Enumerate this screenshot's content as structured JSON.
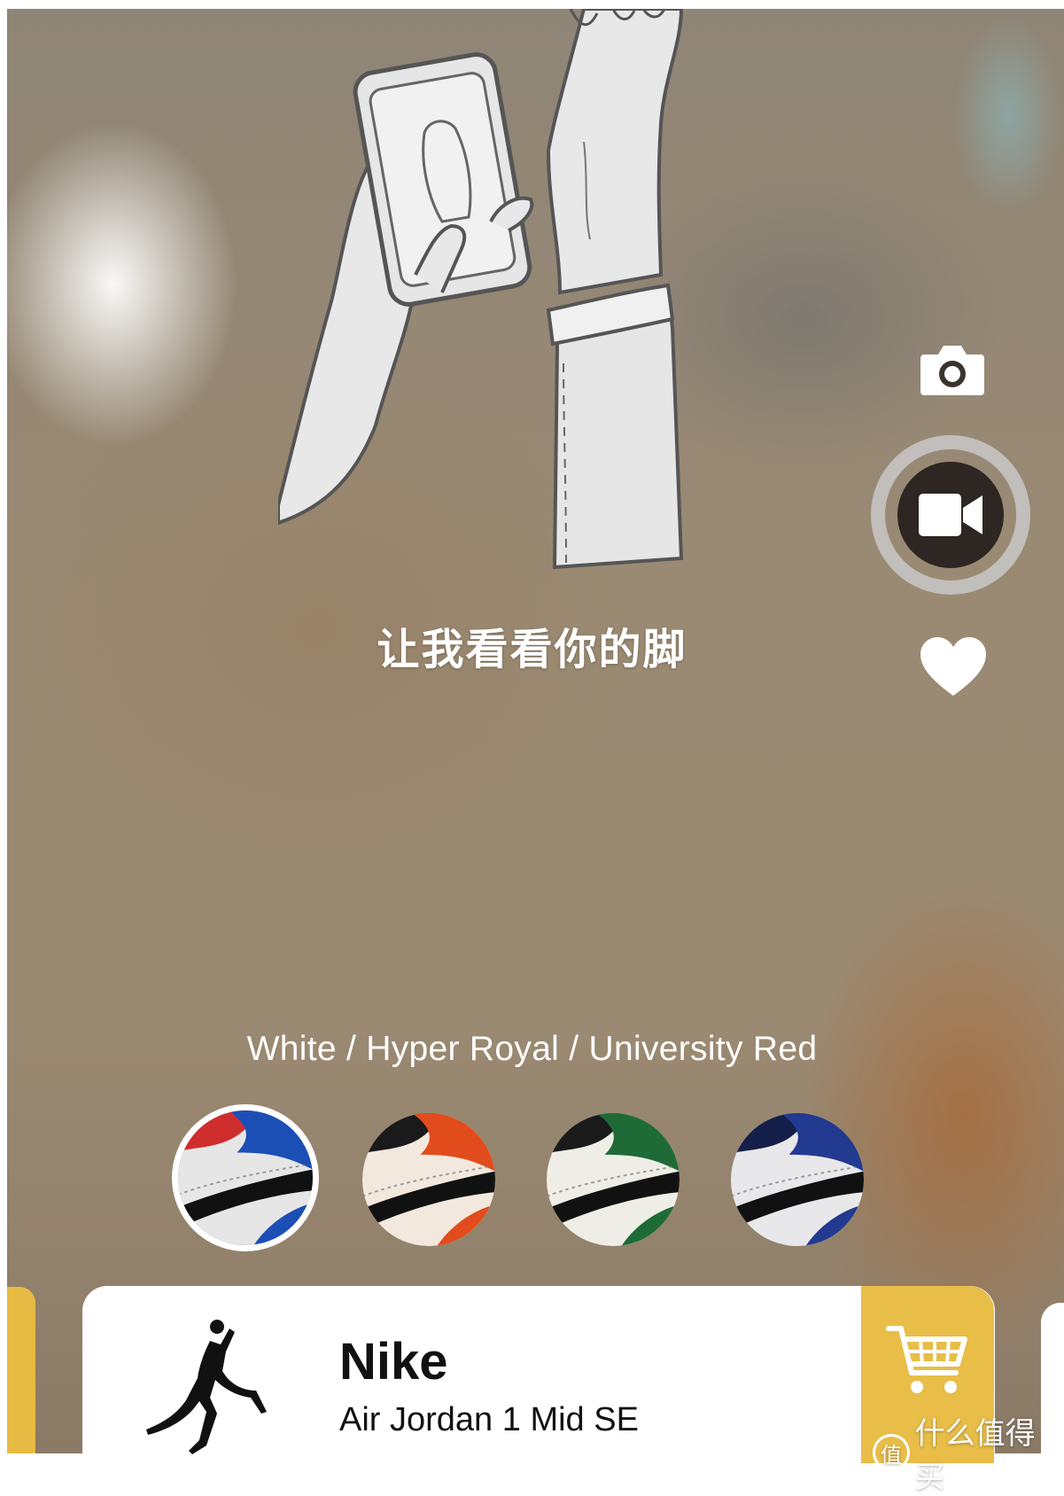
{
  "instruction": "让我看看你的脚",
  "colorway": {
    "name": "White / Hyper Royal / University Red",
    "options": [
      {
        "primary": "#1c4fb5",
        "secondary": "#cf2e2e",
        "base": "#e6e6e6",
        "stripe": "#111111",
        "selected": true
      },
      {
        "primary": "#e24c1c",
        "secondary": "#1a1a1a",
        "base": "#f2e8dd",
        "stripe": "#111111",
        "selected": false
      },
      {
        "primary": "#1f6b37",
        "secondary": "#1a1a1a",
        "base": "#efeee6",
        "stripe": "#111111",
        "selected": false
      },
      {
        "primary": "#223a8f",
        "secondary": "#14204a",
        "base": "#e8e8ea",
        "stripe": "#111111",
        "selected": false
      }
    ]
  },
  "product": {
    "brand": "Nike",
    "model": "Air Jordan 1 Mid SE"
  },
  "side_tools": {
    "photo_icon": "camera-icon",
    "record_icon": "video-camera-icon",
    "like_icon": "heart-icon"
  },
  "cart_icon": "shopping-cart-icon",
  "watermark": {
    "icon": "值",
    "text": "什么值得买"
  },
  "colors": {
    "accent": "#e8bd48",
    "card": "#ffffff"
  }
}
